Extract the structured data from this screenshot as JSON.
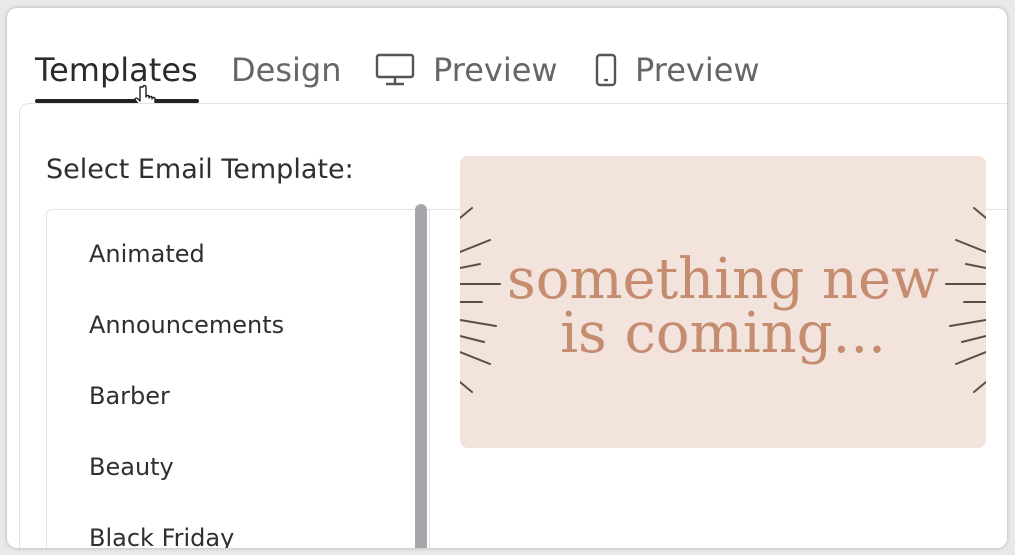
{
  "tabs": [
    {
      "label": "Templates",
      "active": true
    },
    {
      "label": "Design",
      "active": false
    },
    {
      "label": "Preview",
      "icon": "desktop-monitor-icon",
      "active": false
    },
    {
      "label": "Preview",
      "icon": "mobile-phone-icon",
      "active": false
    }
  ],
  "main": {
    "section_title": "Select Email Template:",
    "categories": [
      "Animated",
      "Announcements",
      "Barber",
      "Beauty",
      "Black Friday"
    ]
  },
  "preview": {
    "banner_line1": "something new",
    "banner_line2": "is coming...",
    "colors": {
      "banner_bg": "#f2e4dc",
      "banner_text": "#c58c6f",
      "rays": "#5a4e45"
    }
  },
  "colors": {
    "active_tab_underline": "#222222",
    "scrollbar": "#a7a7ab"
  }
}
